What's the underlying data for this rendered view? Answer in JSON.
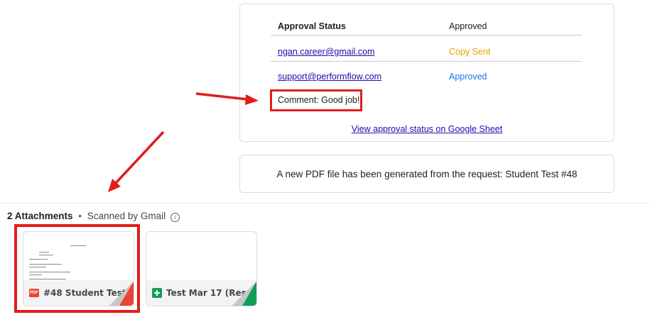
{
  "approval": {
    "header": {
      "status_label": "Approval Status",
      "status_value": "Approved"
    },
    "rows": [
      {
        "email": "ngan.career@gmail.com",
        "status": "Copy Sent",
        "status_color": "#e8a200"
      },
      {
        "email": "support@performflow.com",
        "status": "Approved",
        "status_color": "#1a73e8"
      }
    ],
    "comment": "Comment: Good job!",
    "view_link": "View approval status on Google Sheet"
  },
  "pdf_notice": "A new PDF file has been generated from the request: Student Test #48",
  "attachments": {
    "count_label": "2 Attachments",
    "separator": "•",
    "scanned_label": "Scanned by Gmail",
    "info_glyph": "i",
    "items": [
      {
        "name": "#48 Student Test....",
        "icon": "pdf-icon",
        "badge": "PDF",
        "accent": "#ea4335"
      },
      {
        "name": "Test Mar 17 (Resp...",
        "icon": "sheets-icon",
        "accent": "#0f9d58"
      }
    ]
  },
  "annotation_color": "#e31c1c"
}
